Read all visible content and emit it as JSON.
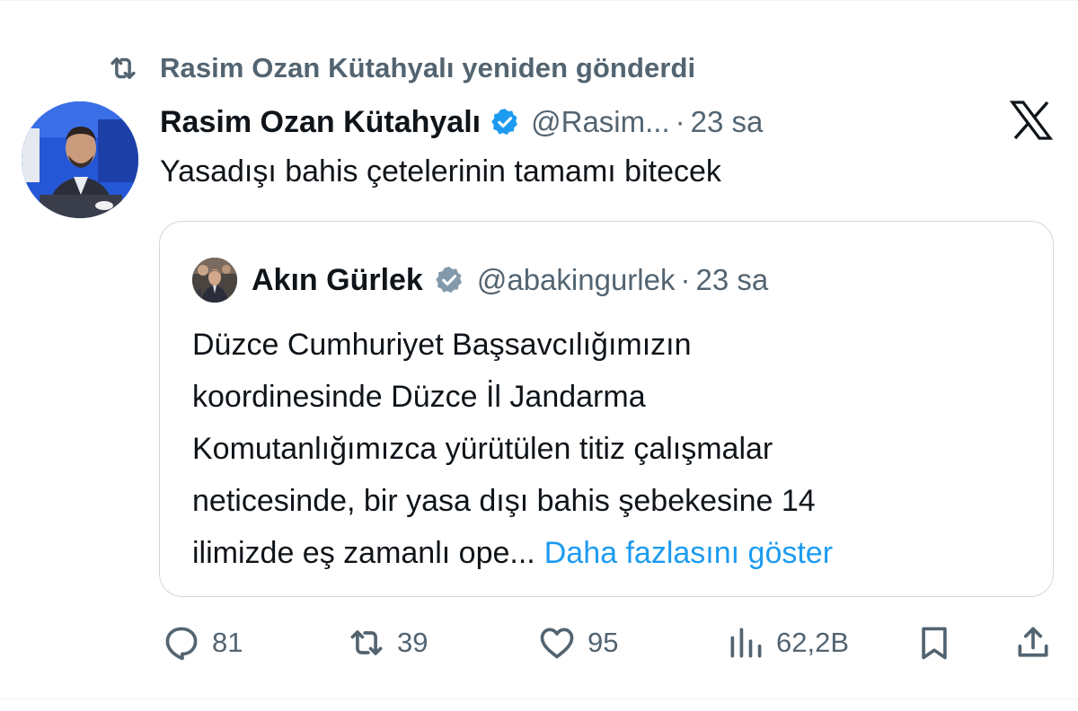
{
  "repost": {
    "label": "Rasim Ozan Kütahyalı yeniden gönderdi",
    "icon": "repost-icon"
  },
  "tweet": {
    "author_name": "Rasim Ozan Kütahyalı",
    "handle": "@Rasim...",
    "separator": "·",
    "time": "23 sa",
    "text": "Yasadışı bahis çetelerinin tamamı bitecek",
    "verified_icon": "verified-badge-icon",
    "brand_icon": "x-logo-icon"
  },
  "quote": {
    "author_name": "Akın Gürlek",
    "handle": "@abakingurlek",
    "separator": "·",
    "time": "23 sa",
    "verified_icon": "gray-verified-badge-icon",
    "lines": [
      "Düzce Cumhuriyet Başsavcılığımızın",
      "koordinesinde Düzce İl Jandarma",
      "Komutanlığımızca yürütülen titiz çalışmalar",
      "neticesinde, bir yasa dışı bahis şebekesine 14",
      "ilimizde eş zamanlı ope..."
    ],
    "show_more": "Daha fazlasını göster"
  },
  "actions": {
    "replies": "81",
    "reposts": "39",
    "likes": "95",
    "views": "62,2B"
  },
  "colors": {
    "text": "#0f1419",
    "secondary": "#536471",
    "link": "#1d9bf0",
    "verified_blue": "#1d9bf0",
    "verified_gray": "#829aab",
    "border": "#cfd9de"
  }
}
